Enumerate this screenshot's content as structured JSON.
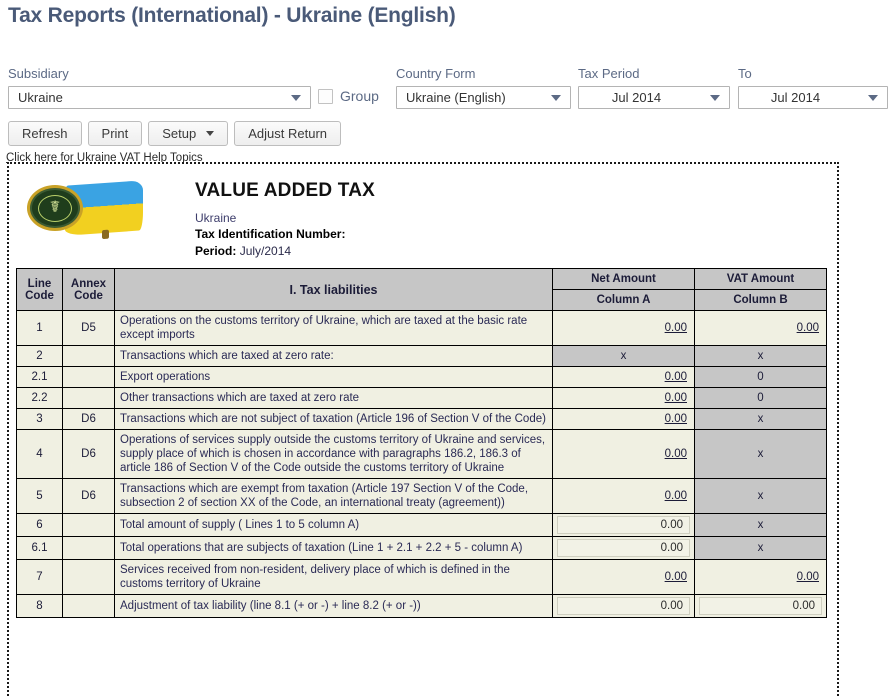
{
  "page_title": "Tax Reports (International) - Ukraine (English)",
  "toolbar": {
    "subsidiary_label": "Subsidiary",
    "subsidiary_value": "Ukraine",
    "group_label": "Group",
    "group_checked": false,
    "country_form_label": "Country Form",
    "country_form_value": "Ukraine (English)",
    "tax_period_label": "Tax Period",
    "tax_period_value": "Jul 2014",
    "to_label": "To",
    "to_value": "Jul 2014",
    "buttons": [
      {
        "label": "Refresh",
        "has_caret": false
      },
      {
        "label": "Print",
        "has_caret": false
      },
      {
        "label": "Setup",
        "has_caret": true
      },
      {
        "label": "Adjust Return",
        "has_caret": false
      }
    ],
    "help_link": "Click here for Ukraine VAT Help Topics"
  },
  "report": {
    "title": "VALUE ADDED TAX",
    "country": "Ukraine",
    "tin_label": "Tax Identification Number:",
    "tin_value": "",
    "period_label": "Period:",
    "period_value": "July/2014",
    "emblem_icon": "ukraine-tax-service-emblem"
  },
  "table": {
    "headers": {
      "line_code": "Line\nCode",
      "line_code_l1": "Line",
      "line_code_l2": "Code",
      "annex_code_l1": "Annex",
      "annex_code_l2": "Code",
      "section": "I. Tax liabilities",
      "net_amount": "Net Amount",
      "vat_amount": "VAT Amount",
      "column_a": "Column A",
      "column_b": "Column B"
    },
    "rows": [
      {
        "line": "1",
        "annex": "D5",
        "desc": "Operations on the customs territory of Ukraine, which are taxed at the basic rate except imports",
        "net": {
          "type": "link",
          "value": "0.00"
        },
        "vat": {
          "type": "link",
          "value": "0.00"
        }
      },
      {
        "line": "2",
        "annex": "",
        "desc": "Transactions which are taxed at zero rate:",
        "net": {
          "type": "gray",
          "value": "x"
        },
        "vat": {
          "type": "gray",
          "value": "x"
        }
      },
      {
        "line": "2.1",
        "annex": "",
        "desc": "Export operations",
        "net": {
          "type": "link",
          "value": "0.00"
        },
        "vat": {
          "type": "gray",
          "value": "0"
        }
      },
      {
        "line": "2.2",
        "annex": "",
        "desc": "Other transactions which are taxed at zero rate",
        "net": {
          "type": "link",
          "value": "0.00"
        },
        "vat": {
          "type": "gray",
          "value": "0"
        }
      },
      {
        "line": "3",
        "annex": "D6",
        "desc": "Transactions which are not subject of taxation (Article 196 of Section V of the Code)",
        "net": {
          "type": "link",
          "value": "0.00"
        },
        "vat": {
          "type": "gray",
          "value": "x"
        }
      },
      {
        "line": "4",
        "annex": "D6",
        "desc": "Operations of services supply outside the customs territory of Ukraine and services, supply place of which is chosen in accordance with paragraphs 186.2, 186.3 of article 186 of Section V of the Code outside the customs territory of Ukraine",
        "net": {
          "type": "link",
          "value": "0.00"
        },
        "vat": {
          "type": "gray",
          "value": "x"
        }
      },
      {
        "line": "5",
        "annex": "D6",
        "desc": "Transactions which are exempt from taxation (Article 197 Section V of the Code, subsection 2 of section XX of the Code, an international treaty (agreement))",
        "net": {
          "type": "link",
          "value": "0.00"
        },
        "vat": {
          "type": "gray",
          "value": "x"
        }
      },
      {
        "line": "6",
        "annex": "",
        "desc": "Total amount of supply ( Lines 1 to 5 column A)",
        "net": {
          "type": "input",
          "value": "0.00"
        },
        "vat": {
          "type": "gray",
          "value": "x"
        }
      },
      {
        "line": "6.1",
        "annex": "",
        "desc": "Total operations that are subjects of taxation (Line 1 + 2.1 + 2.2 + 5 - column A)",
        "net": {
          "type": "input",
          "value": "0.00"
        },
        "vat": {
          "type": "gray",
          "value": "x"
        }
      },
      {
        "line": "7",
        "annex": "",
        "desc": "Services received from non-resident, delivery place of which is defined in the customs territory of Ukraine",
        "net": {
          "type": "link",
          "value": "0.00"
        },
        "vat": {
          "type": "link",
          "value": "0.00"
        }
      },
      {
        "line": "8",
        "annex": "",
        "desc": "Adjustment of tax liability (line 8.1 (+ or -) + line 8.2 (+ or -))",
        "net": {
          "type": "input",
          "value": "0.00"
        },
        "vat": {
          "type": "input",
          "value": "0.00"
        }
      }
    ]
  }
}
